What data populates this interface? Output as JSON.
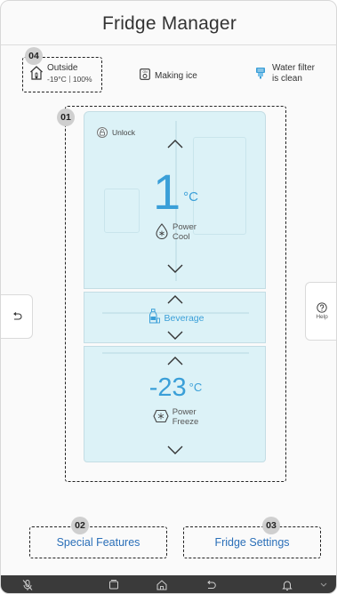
{
  "header": {
    "title": "Fridge Manager"
  },
  "status": {
    "outside": {
      "label": "Outside",
      "temp": "-19°C",
      "humidity": "100%",
      "icon": "house-thermometer-icon"
    },
    "ice": {
      "label": "Making ice",
      "icon": "ice-maker-icon"
    },
    "filter": {
      "line1": "Water filter",
      "line2": "is clean",
      "icon": "water-filter-icon"
    }
  },
  "callouts": {
    "c1": "01",
    "c2": "02",
    "c3": "03",
    "c4": "04"
  },
  "fridge": {
    "lock_label": "Unlock",
    "upper": {
      "temp": "1",
      "unit": "°C",
      "mode_line1": "Power",
      "mode_line2": "Cool"
    },
    "middle": {
      "label": "Beverage"
    },
    "lower": {
      "temp": "-23",
      "unit": "°C",
      "mode_line1": "Power",
      "mode_line2": "Freeze"
    }
  },
  "side": {
    "help_label": "Help"
  },
  "bottom": {
    "special_features": "Special Features",
    "fridge_settings": "Fridge Settings"
  },
  "colors": {
    "accent": "#3a9fd8",
    "link": "#2a6fb8",
    "compartment": "#dcf2f7",
    "navbar": "#3a3a3a"
  }
}
